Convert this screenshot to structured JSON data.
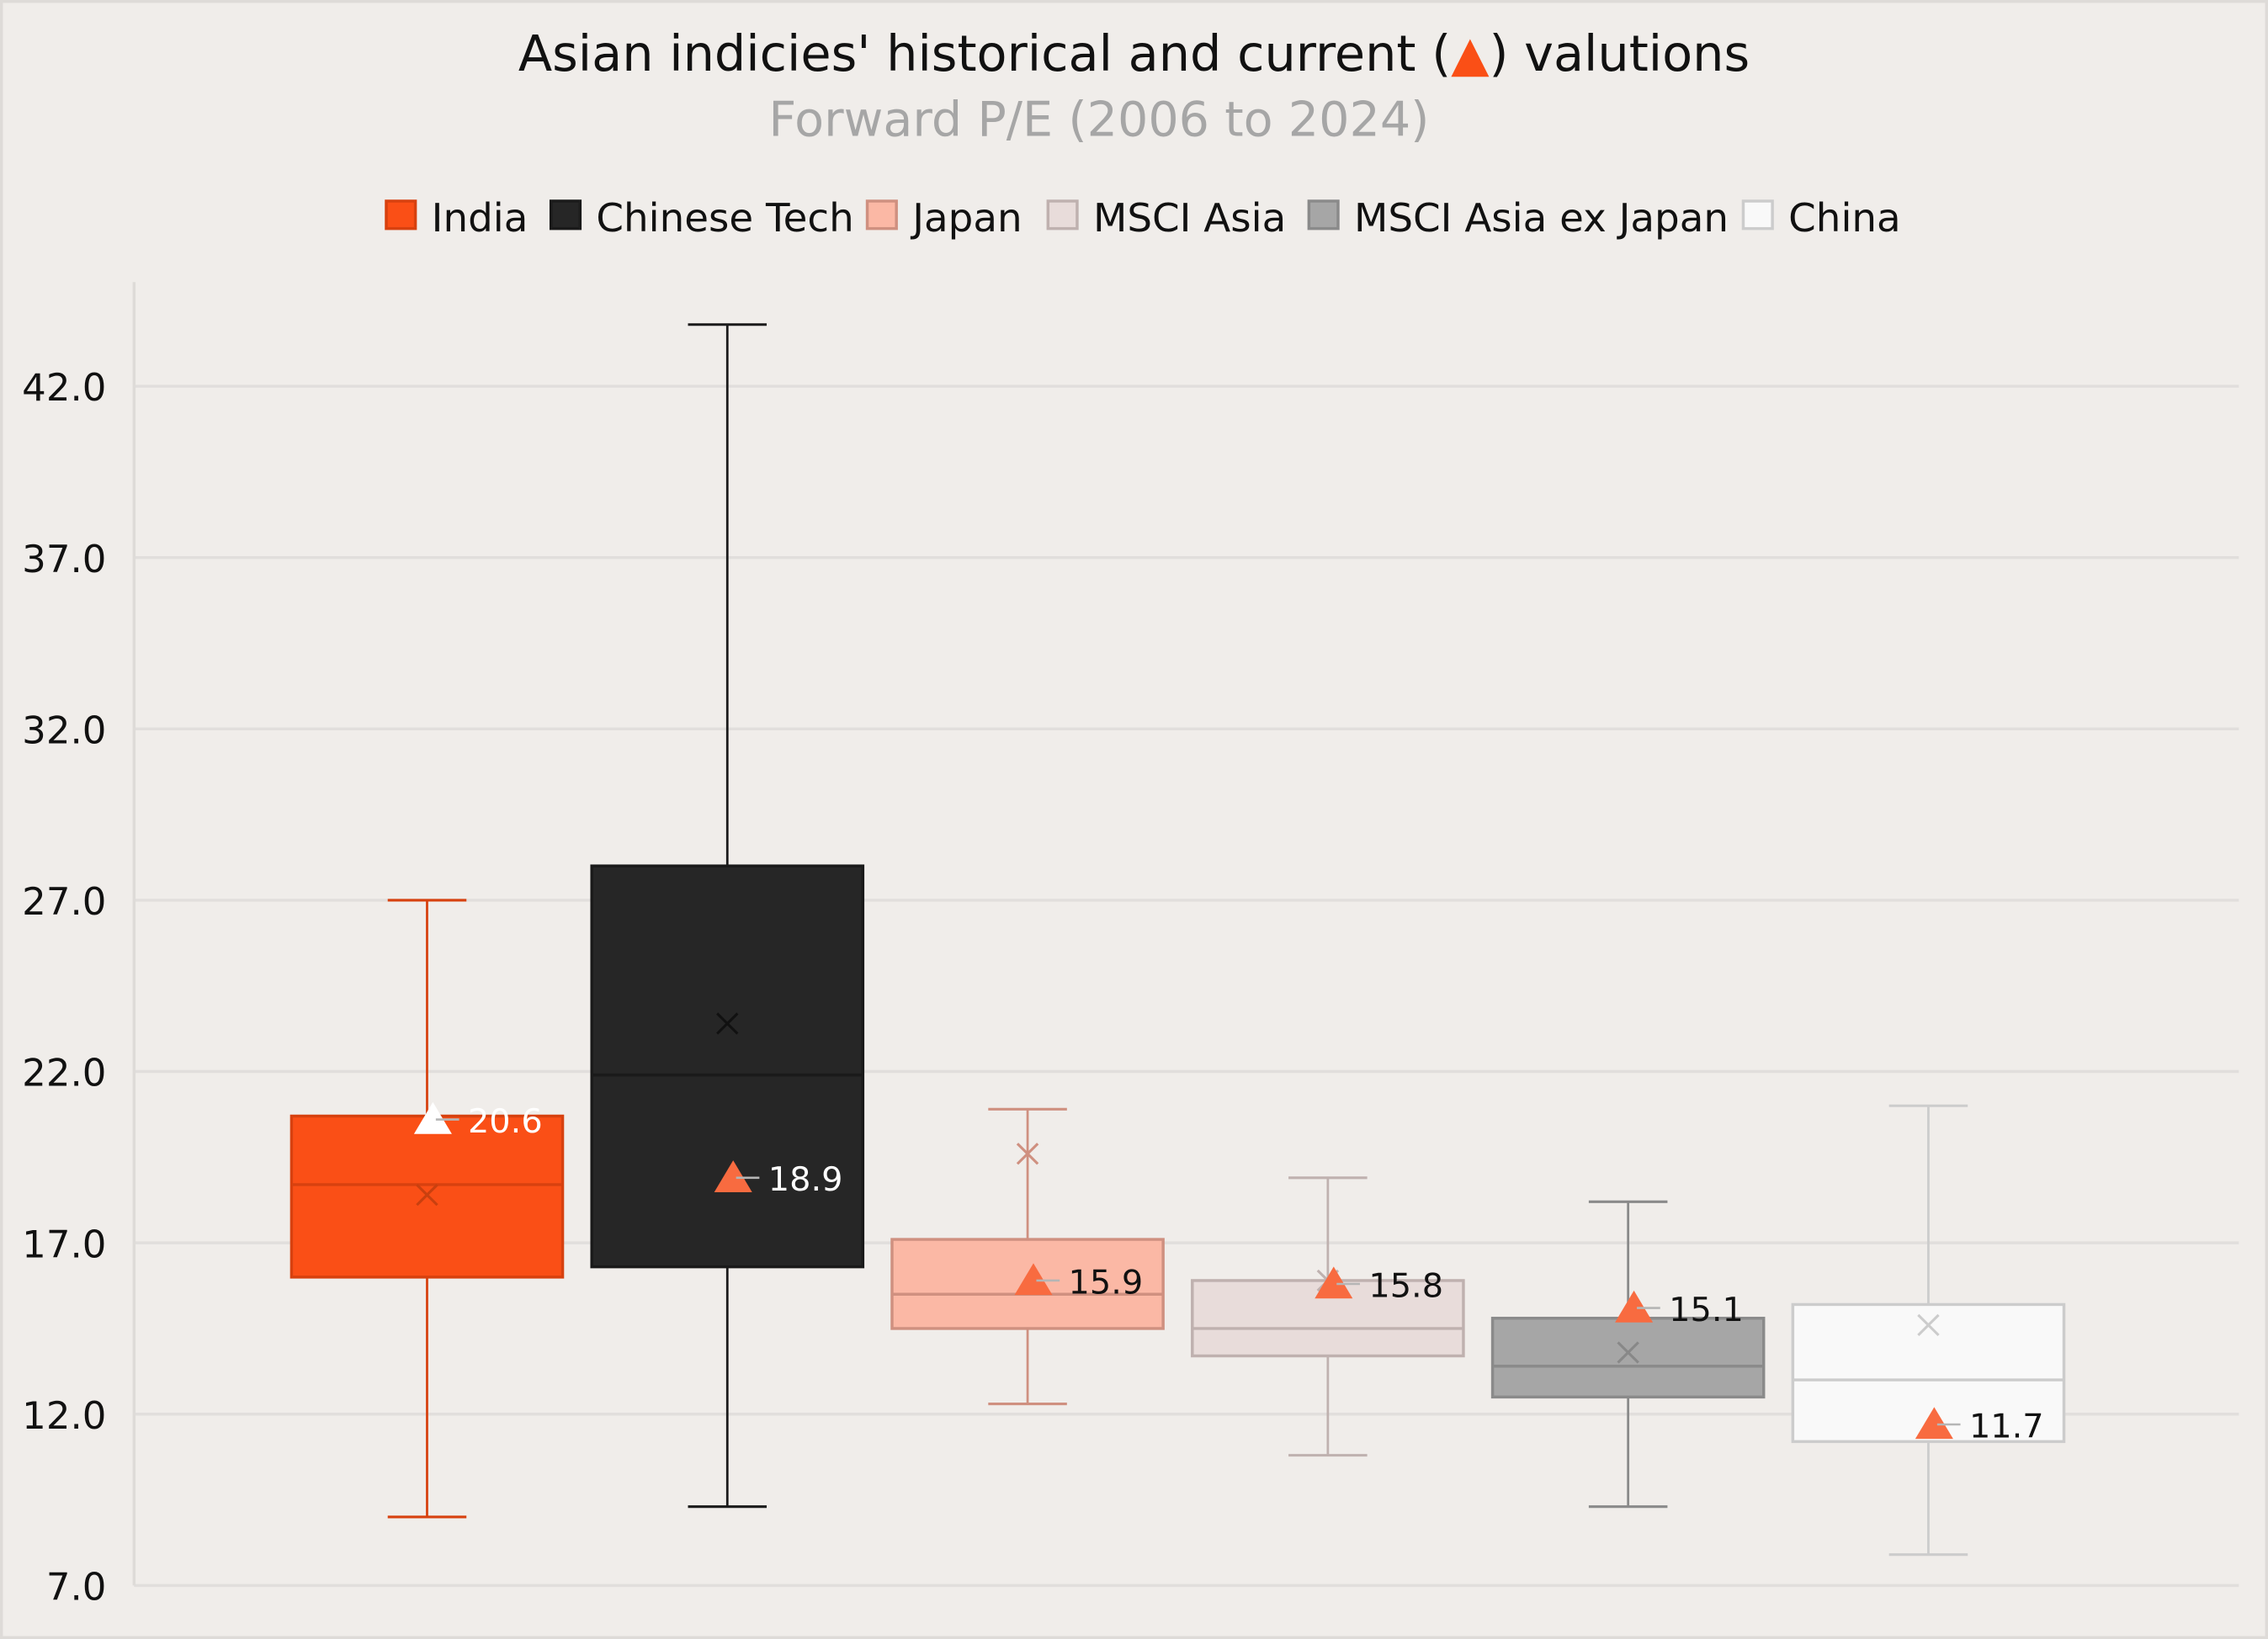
{
  "chart_data": {
    "type": "boxplot",
    "title": "Asian indicies' historical and current (▲) valutions",
    "title_parts": {
      "before": "Asian indicies' historical and current (",
      "marker": "▲",
      "after": ") valutions"
    },
    "subtitle": "Forward P/E (2006 to 2024)",
    "xlabel": "",
    "ylabel": "",
    "ylim": [
      7.0,
      45.0
    ],
    "yticks": [
      7.0,
      12.0,
      17.0,
      22.0,
      27.0,
      32.0,
      37.0,
      42.0
    ],
    "ytick_labels": [
      "7.0",
      "12.0",
      "17.0",
      "22.0",
      "27.0",
      "32.0",
      "37.0",
      "42.0"
    ],
    "grid": true,
    "legend_position": "top-center",
    "current_marker": "triangle",
    "current_marker_color": "#f86b40",
    "series": [
      {
        "name": "India",
        "min": 9.0,
        "q1": 16.0,
        "median": 18.7,
        "mean": 18.4,
        "q3": 20.7,
        "max": 27.0,
        "current": 20.6,
        "current_label": "20.6",
        "fill": "#fa4f16",
        "stroke": "#d7410f",
        "mean_color": "#c9400f",
        "label_color": "#ffffff",
        "marker_color": "#ffffff"
      },
      {
        "name": "Chinese Tech",
        "min": 9.3,
        "q1": 16.3,
        "median": 21.9,
        "mean": 23.4,
        "q3": 28.0,
        "max": 43.8,
        "current": 18.9,
        "current_label": "18.9",
        "fill": "#262626",
        "stroke": "#1a1a1a",
        "mean_color": "#111111",
        "label_color": "#ffffff",
        "marker_color": "#f86b40"
      },
      {
        "name": "Japan",
        "min": 12.3,
        "q1": 14.5,
        "median": 15.5,
        "mean": 19.6,
        "q3": 17.1,
        "max": 20.9,
        "current": 15.9,
        "current_label": "15.9",
        "fill": "#fbb8a5",
        "stroke": "#cf9080",
        "mean_color": "#cf9080",
        "label_color": "#111111",
        "marker_color": "#f86b40"
      },
      {
        "name": "MSCI Asia",
        "min": 10.8,
        "q1": 13.7,
        "median": 14.5,
        "mean": 15.9,
        "q3": 15.9,
        "max": 18.9,
        "current": 15.8,
        "current_label": "15.8",
        "fill": "#e8dcda",
        "stroke": "#bfb1af",
        "mean_color": "#bfb1af",
        "label_color": "#111111",
        "marker_color": "#f86b40"
      },
      {
        "name": "MSCI Asia ex Japan",
        "min": 9.3,
        "q1": 12.5,
        "median": 13.4,
        "mean": 13.8,
        "q3": 14.8,
        "max": 18.2,
        "current": 15.1,
        "current_label": "15.1",
        "fill": "#a6a6a6",
        "stroke": "#8a8a8a",
        "mean_color": "#888888",
        "label_color": "#111111",
        "marker_color": "#f86b40"
      },
      {
        "name": "China",
        "min": 7.9,
        "q1": 11.2,
        "median": 13.0,
        "mean": 14.6,
        "q3": 15.2,
        "max": 21.0,
        "current": 11.7,
        "current_label": "11.7",
        "fill": "#f9f9f9",
        "stroke": "#cccccc",
        "mean_color": "#cccccc",
        "label_color": "#111111",
        "marker_color": "#f86b40"
      }
    ]
  },
  "colors": {
    "background": "#f0edea",
    "grid": "#e1dedc",
    "title_marker": "#fa4f16"
  }
}
